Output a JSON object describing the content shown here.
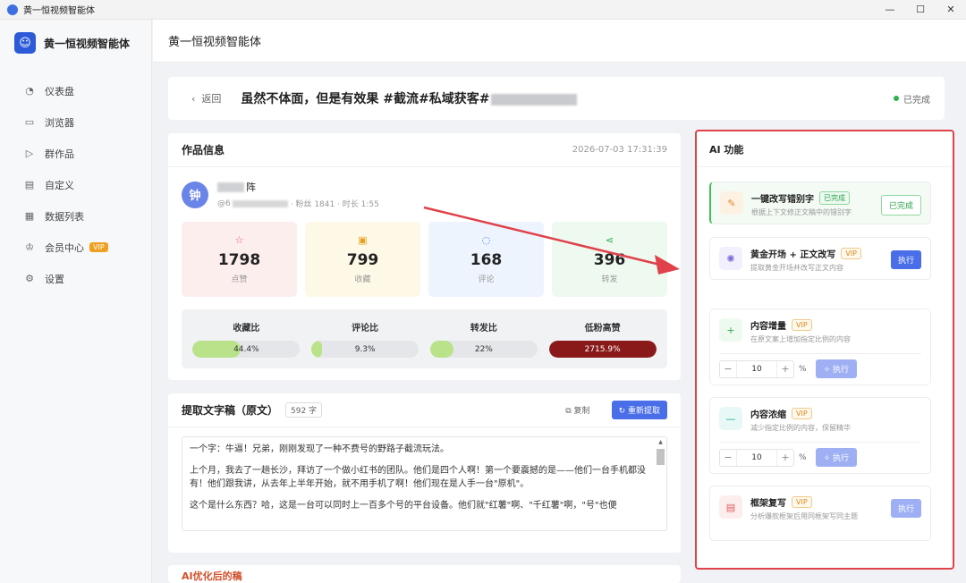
{
  "window": {
    "title": "黄一恒视频智能体",
    "controls": [
      "—",
      "☐",
      "✕"
    ]
  },
  "sidebar": {
    "brand": "黄一恒视频智能体",
    "items": [
      {
        "label": "仪表盘",
        "icon": "dashboard-icon",
        "glyph": "◔"
      },
      {
        "label": "浏览器",
        "icon": "monitor-icon",
        "glyph": "▭"
      },
      {
        "label": "群作品",
        "icon": "video-icon",
        "glyph": "▷"
      },
      {
        "label": "自定义",
        "icon": "clipboard-icon",
        "glyph": "▤"
      },
      {
        "label": "数据列表",
        "icon": "document-icon",
        "glyph": "▦"
      },
      {
        "label": "会员中心",
        "icon": "crown-icon",
        "glyph": "♔",
        "badge": "VIP"
      },
      {
        "label": "设置",
        "icon": "gear-icon",
        "glyph": "⚙"
      }
    ]
  },
  "topbar": {
    "title": "黄一恒视频智能体"
  },
  "header": {
    "back": "返回",
    "video_title": "虽然不体面，但是有效果 #截流#私域获客#",
    "status": "已完成"
  },
  "info": {
    "title": "作品信息",
    "time": "2026-07-03 17:31:39",
    "author_initial": "钟",
    "author_name_suffix": "阵",
    "meta_prefix": "@6",
    "meta_suffix": "· 粉丝 1841 · 时长 1:55",
    "stats": [
      {
        "value": "1798",
        "label": "点赞",
        "icon": "star-icon",
        "glyph": "☆",
        "color": "#e25a5a",
        "bg": "#fdeeee"
      },
      {
        "value": "799",
        "label": "收藏",
        "icon": "bookmark-icon",
        "glyph": "▣",
        "color": "#e6a21a",
        "bg": "#fef8e6"
      },
      {
        "value": "168",
        "label": "评论",
        "icon": "comment-icon",
        "glyph": "◌",
        "color": "#3d7ee6",
        "bg": "#edf4fe"
      },
      {
        "value": "396",
        "label": "转发",
        "icon": "share-icon",
        "glyph": "⋖",
        "color": "#2fa84f",
        "bg": "#eefaf0"
      }
    ],
    "ratios": [
      {
        "label": "收藏比",
        "value": "44.4%",
        "fill": 0.444,
        "color": "#b9e28a"
      },
      {
        "label": "评论比",
        "value": "9.3%",
        "fill": 0.093,
        "color": "#b9e28a"
      },
      {
        "label": "转发比",
        "value": "22%",
        "fill": 0.22,
        "color": "#b9e28a"
      },
      {
        "label": "低粉高赞",
        "value": "2715.9%",
        "fill": 1.0,
        "color": "#8a1a1a"
      }
    ]
  },
  "transcript": {
    "title": "提取文字稿（原文）",
    "count": "592 字",
    "copy": "复制",
    "refresh": "重新提取",
    "paragraphs": [
      "一个字：牛逼！兄弟，刚刚发现了一种不费号的野路子截流玩法。",
      "上个月，我去了一趟长沙，拜访了一个做小红书的团队。他们是四个人啊！第一个要震撼的是——他们一台手机都没有！他们跟我讲，从去年上半年开始，就不用手机了啊！他们现在是人手一台\"原机\"。",
      "这个是什么东西？哈，这是一台可以同时上一百多个号的平台设备。他们就\"红薯\"啊、\"千红薯\"啊，\"号\"也便"
    ]
  },
  "ai": {
    "title": "AI 功能",
    "features": [
      {
        "name": "一键改写错别字",
        "tag": "已完成",
        "tag_type": "done",
        "desc": "根据上下文修正文稿中的错别字",
        "button": "已完成",
        "btn_type": "done",
        "icon": "pencil-icon",
        "glyph": "✎",
        "icolor": "#e08a2a",
        "ibg": "#fdf1e4"
      },
      {
        "name": "黄金开场 + 正文改写",
        "tag": "VIP",
        "tag_type": "vip",
        "desc": "提取黄金开场并改写正文内容",
        "button": "执行",
        "btn_type": "run",
        "icon": "sparkle-icon",
        "glyph": "✺",
        "icolor": "#7a6ad8",
        "ibg": "#f2f0fc"
      },
      {
        "name": "内容增量",
        "tag": "VIP",
        "tag_type": "vip",
        "desc": "在原文案上增加指定比例的内容",
        "stepper": "10",
        "pct": "%",
        "button": "执行",
        "icon": "plus-icon",
        "glyph": "+",
        "icolor": "#2fa84f",
        "ibg": "#eefaf0"
      },
      {
        "name": "内容浓缩",
        "tag": "VIP",
        "tag_type": "vip",
        "desc": "减少指定比例的内容，保留精华",
        "stepper": "10",
        "pct": "%",
        "button": "执行",
        "icon": "minus-icon",
        "glyph": "—",
        "icolor": "#1aa39a",
        "ibg": "#e8f8f6"
      },
      {
        "name": "框架复写",
        "tag": "VIP",
        "tag_type": "vip",
        "desc": "分析爆款框架后用同框架写同主题",
        "button": "执行",
        "btn_type": "run-light",
        "icon": "file-icon",
        "glyph": "▤",
        "icolor": "#e25a5a",
        "ibg": "#fdeeee"
      }
    ]
  },
  "next_section": {
    "title": "AI优化后的稿"
  },
  "colors": {
    "accent": "#4a6ee8",
    "highlight": "#e0414a",
    "success": "#2bb34b"
  }
}
